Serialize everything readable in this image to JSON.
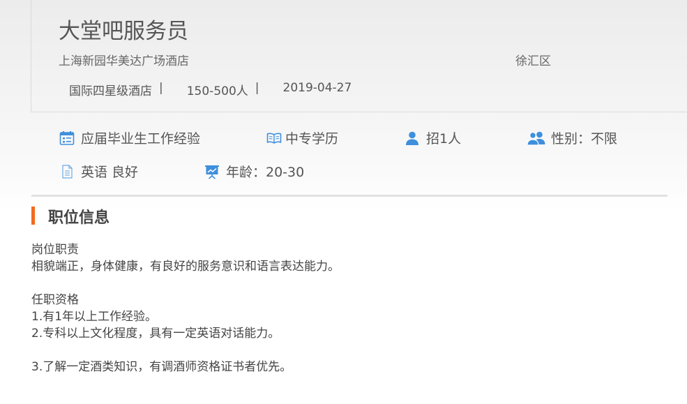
{
  "job": {
    "title": "大堂吧服务员",
    "company": "上海新园华美达广场酒店",
    "district": "徐汇区",
    "hotel_type": "国际四星级酒店",
    "size": "150-500人",
    "date": "2019-04-27",
    "separator": "|"
  },
  "attributes": {
    "experience": "应届毕业生工作经验",
    "education": "中专学历",
    "headcount": "招1人",
    "gender": "性别：不限",
    "language": "英语 良好",
    "age": "年龄：20-30"
  },
  "colors": {
    "icon_blue": "#3f8fdd",
    "accent_orange": "#f36b1c"
  },
  "section": {
    "title": "职位信息"
  },
  "description": {
    "duties_heading": "岗位职责",
    "duties_text": "相貌端正，身体健康，有良好的服务意识和语言表达能力。",
    "qual_heading": "任职资格",
    "qual_1": "1.有1年以上工作经验。",
    "qual_2": "2.专科以上文化程度，具有一定英语对话能力。",
    "qual_3": "3.了解一定酒类知识，有调酒师资格证书者优先。"
  }
}
